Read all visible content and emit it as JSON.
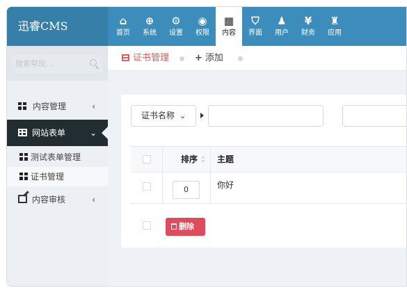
{
  "app": {
    "logo": "迅睿CMS"
  },
  "topnav": [
    {
      "icon": "home-icon",
      "glyph": "⌂",
      "label": "首页",
      "active": false
    },
    {
      "icon": "globe-icon",
      "glyph": "⊕",
      "label": "系统",
      "active": false
    },
    {
      "icon": "gears-icon",
      "glyph": "⚙",
      "label": "设置",
      "active": false
    },
    {
      "icon": "user-circle-icon",
      "glyph": "◉",
      "label": "权限",
      "active": false
    },
    {
      "icon": "grid-icon",
      "glyph": "▦",
      "label": "内容",
      "active": true
    },
    {
      "icon": "html5-icon",
      "glyph": "⛉",
      "label": "界面",
      "active": false
    },
    {
      "icon": "user-icon",
      "glyph": "♟",
      "label": "用户",
      "active": false
    },
    {
      "icon": "yen-icon",
      "glyph": "¥",
      "label": "财务",
      "active": false
    },
    {
      "icon": "puzzle-icon",
      "glyph": "♜",
      "label": "应用",
      "active": false
    }
  ],
  "sidebar": {
    "search_placeholder": "搜索帮助...",
    "menu": [
      {
        "label": "内容管理",
        "chevron": "‹",
        "open": false
      },
      {
        "label": "网站表单",
        "chevron": "⌄",
        "open": true
      },
      {
        "label": "内容审核",
        "chevron": "‹",
        "open": false
      }
    ],
    "subitems": [
      {
        "label": "测试表单管理",
        "active": false
      },
      {
        "label": "证书管理",
        "active": true
      }
    ]
  },
  "tabs": [
    {
      "label": "证书管理",
      "active": true
    },
    {
      "label": "添加",
      "active": false
    }
  ],
  "search": {
    "field_select": "证书名称",
    "keyword_value": "",
    "extra_value": ""
  },
  "table": {
    "headers": {
      "order": "排序",
      "title": "主题"
    },
    "rows": [
      {
        "order": "0",
        "title": "你好"
      }
    ]
  },
  "actions": {
    "delete_label": "删除"
  },
  "colors": {
    "header": "#3c8dbc",
    "logo_bg": "#367fa9",
    "accent_red": "#dd4b5e",
    "tab_red": "#e05a5a",
    "sidebar_active": "#222d32"
  }
}
